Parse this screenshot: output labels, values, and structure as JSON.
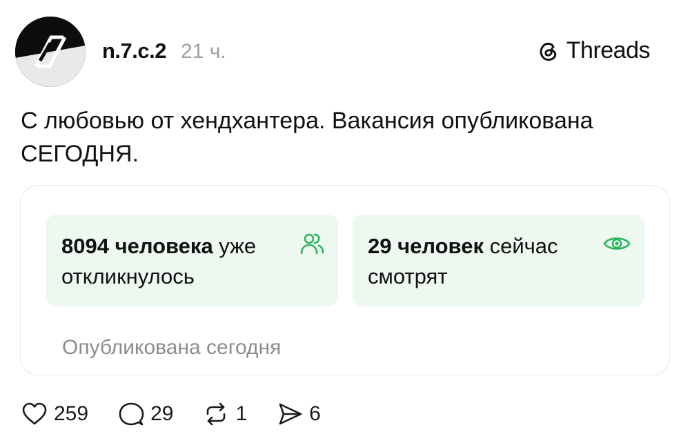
{
  "post": {
    "username": "n.7.c.2",
    "time": "21 ч.",
    "avatar_icon": "zn-logo-avatar",
    "brand": {
      "label": "Threads",
      "icon": "threads-logo-icon"
    },
    "text_line1": "С любовью от хендхантера. Вакансия опубликована",
    "text_line2": "СЕГОДНЯ."
  },
  "card": {
    "responses": {
      "count": "8094 человека",
      "rest": " уже",
      "line2": "откликнулось",
      "icon": "people-icon"
    },
    "viewers": {
      "count": "29 человек",
      "rest": " сейчас",
      "line2": "смотрят",
      "icon": "eye-icon"
    },
    "footer": "Опубликована сегодня",
    "accent": "#2bb45a",
    "tile_bg": "#edf8f0"
  },
  "actions": {
    "likes": "259",
    "comments": "29",
    "reposts": "1",
    "shares": "6"
  }
}
